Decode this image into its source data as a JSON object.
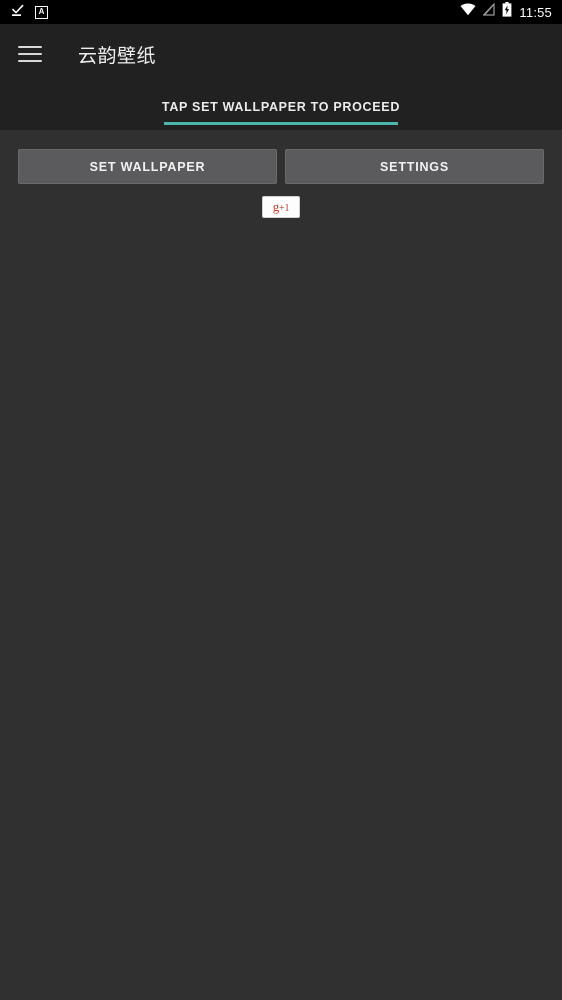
{
  "statusbar": {
    "icons_left": [
      {
        "name": "download-complete-icon",
        "glyph": "check-download"
      },
      {
        "name": "app-notification-icon",
        "glyph": "A"
      }
    ],
    "icons_right": [
      {
        "name": "wifi-icon",
        "glyph": "wifi"
      },
      {
        "name": "no-signal-icon",
        "glyph": "signal-off"
      },
      {
        "name": "battery-charging-icon",
        "glyph": "battery-bolt"
      }
    ],
    "app_badge_letter": "A",
    "time": "11:55"
  },
  "appbar": {
    "menu_icon": "hamburger-menu-icon",
    "title": "云韵壁纸"
  },
  "tabs": [
    {
      "label": "TAP SET WALLPAPER TO PROCEED",
      "selected": true
    }
  ],
  "main": {
    "buttons": [
      {
        "label": "SET WALLPAPER",
        "name": "set-wallpaper-button"
      },
      {
        "label": "SETTINGS",
        "name": "settings-button"
      }
    ],
    "gplus": {
      "label_g": "g",
      "label_plus_one": "+1"
    }
  },
  "colors": {
    "statusbar_bg": "#000000",
    "appbar_bg": "#212121",
    "tabbar_bg": "#212121",
    "content_bg": "#303030",
    "tab_indicator": "#4db6ac",
    "button_bg": "#5b5b5d",
    "gplus_red": "#c1392b"
  }
}
